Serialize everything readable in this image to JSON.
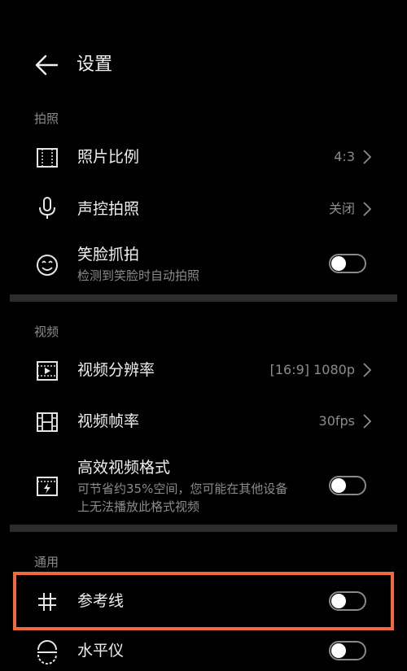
{
  "header": {
    "title": "设置",
    "back_icon": "arrow-left-icon"
  },
  "sections": {
    "photo": {
      "label": "拍照",
      "aspect_ratio": {
        "label": "照片比例",
        "value": "4:3"
      },
      "voice_capture": {
        "label": "声控拍照",
        "value": "关闭"
      },
      "smile_capture": {
        "label": "笑脸抓拍",
        "sub": "检测到笑脸时自动拍照",
        "enabled": false
      }
    },
    "video": {
      "label": "视频",
      "resolution": {
        "label": "视频分辨率",
        "value": "[16:9] 1080p"
      },
      "frame_rate": {
        "label": "视频帧率",
        "value": "30fps"
      },
      "efficient_format": {
        "label": "高效视频格式",
        "sub1": "可节省约35%空间，您可能在其他设备",
        "sub2": "上无法播放此格式视频",
        "enabled": false
      }
    },
    "general": {
      "label": "通用",
      "grid_lines": {
        "label": "参考线",
        "enabled": false
      },
      "level": {
        "label": "水平仪",
        "enabled": false
      }
    }
  },
  "colors": {
    "background": "#000000",
    "highlight": "#f26a3c",
    "divider": "#2c2c2c"
  }
}
